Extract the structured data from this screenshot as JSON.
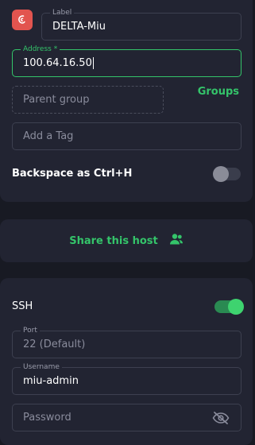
{
  "general": {
    "label": {
      "label": "Label",
      "value": "DELTA-Miu"
    },
    "address": {
      "label": "Address *",
      "value": "100.64.16.50"
    },
    "parent_group": {
      "placeholder": "Parent group"
    },
    "groups_link": "Groups",
    "tag": {
      "placeholder": "Add a Tag"
    },
    "backspace": {
      "label": "Backspace as Ctrl+H",
      "enabled": false
    }
  },
  "share": {
    "label": "Share this host",
    "icon": "users-icon"
  },
  "ssh": {
    "label": "SSH",
    "enabled": true,
    "port": {
      "label": "Port",
      "placeholder": "22 (Default)"
    },
    "username": {
      "label": "Username",
      "value": "miu-admin"
    },
    "password": {
      "placeholder": "Password",
      "icon": "eye-off-icon"
    }
  },
  "colors": {
    "accent": "#34c46a",
    "card": "#222432",
    "background": "#181a23",
    "os_icon": "#e2544f"
  }
}
